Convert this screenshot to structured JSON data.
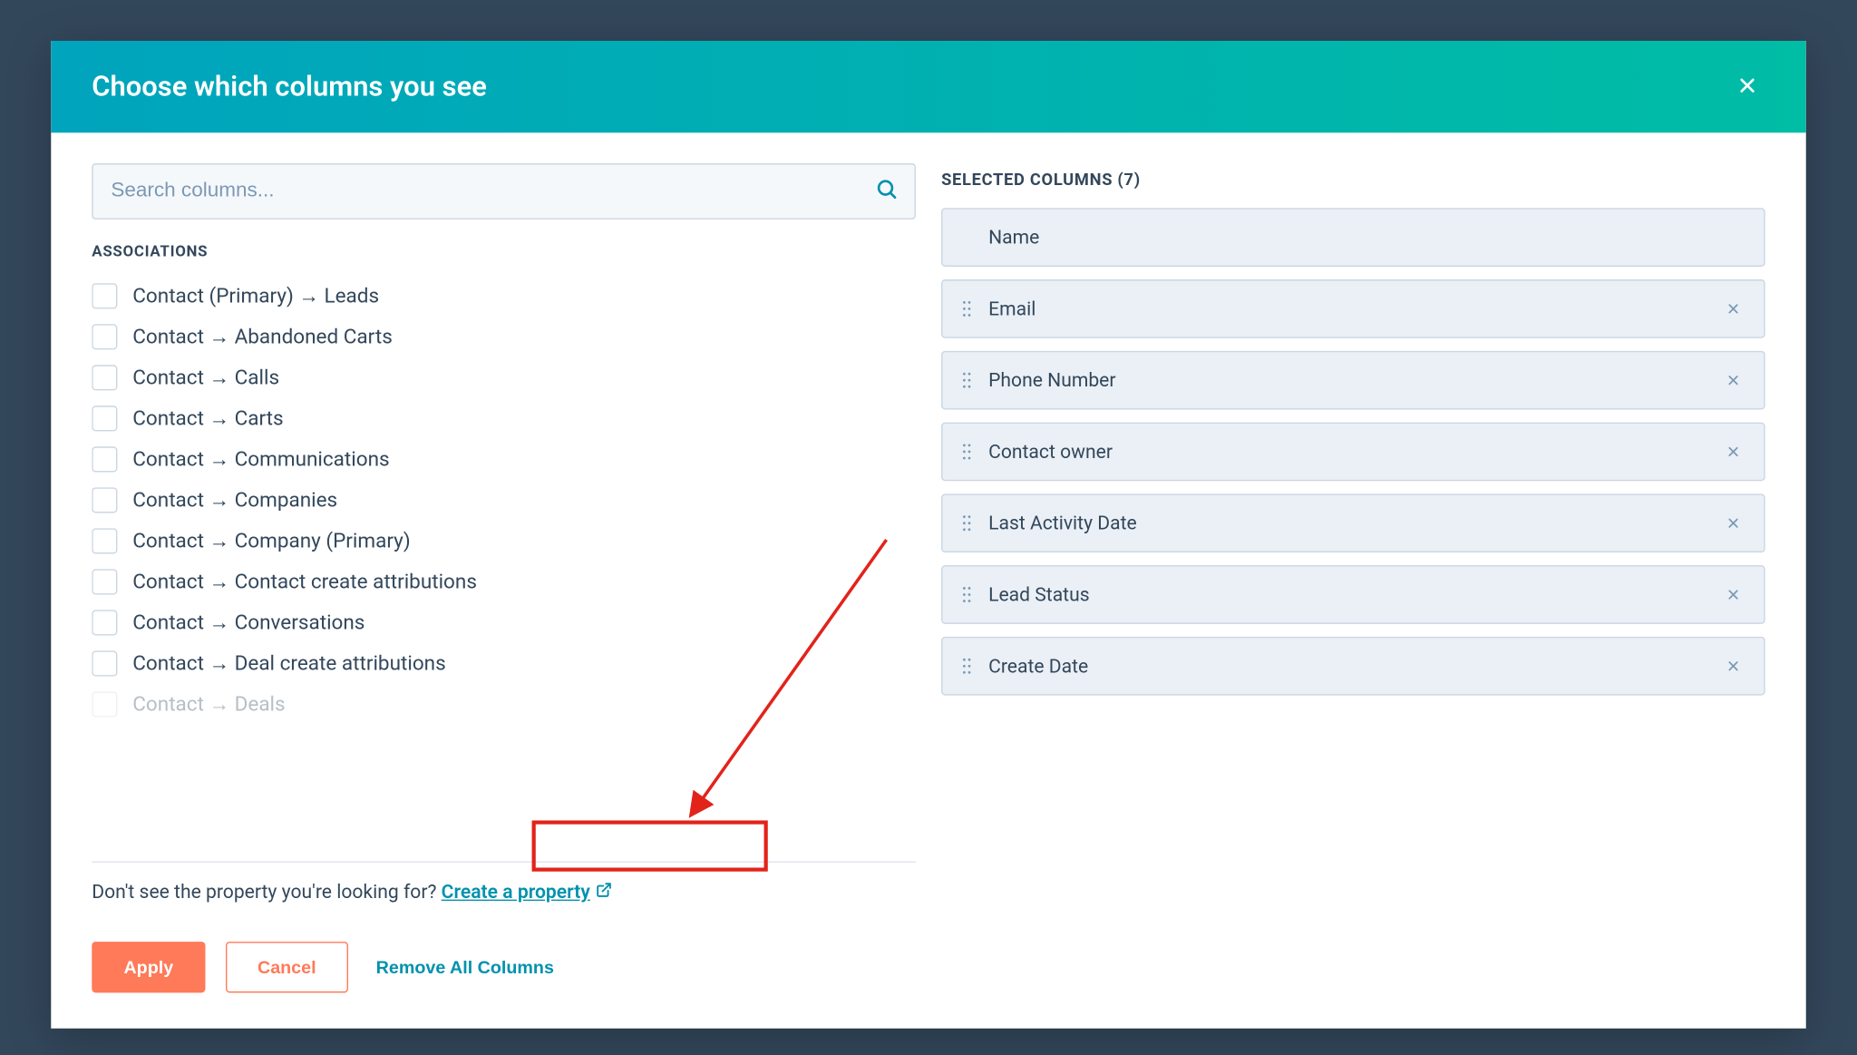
{
  "modal": {
    "title": "Choose which columns you see",
    "search_placeholder": "Search columns..."
  },
  "associations": {
    "section_label": "Associations",
    "items": [
      {
        "label": "Contact (Primary) → Leads"
      },
      {
        "label": "Contact → Abandoned Carts"
      },
      {
        "label": "Contact → Calls"
      },
      {
        "label": "Contact → Carts"
      },
      {
        "label": "Contact → Communications"
      },
      {
        "label": "Contact → Companies"
      },
      {
        "label": "Contact → Company (Primary)"
      },
      {
        "label": "Contact → Contact create attributions"
      },
      {
        "label": "Contact → Conversations"
      },
      {
        "label": "Contact → Deal create attributions"
      },
      {
        "label": "Contact → Deals"
      }
    ]
  },
  "selected": {
    "header": "SELECTED COLUMNS (7)",
    "items": [
      {
        "label": "Name",
        "locked": true
      },
      {
        "label": "Email",
        "locked": false
      },
      {
        "label": "Phone Number",
        "locked": false
      },
      {
        "label": "Contact owner",
        "locked": false
      },
      {
        "label": "Last Activity Date",
        "locked": false
      },
      {
        "label": "Lead Status",
        "locked": false
      },
      {
        "label": "Create Date",
        "locked": false
      }
    ]
  },
  "create_property": {
    "prompt": "Don't see the property you're looking for? ",
    "link_text": "Create a property"
  },
  "footer": {
    "apply": "Apply",
    "cancel": "Cancel",
    "remove_all": "Remove All Columns"
  }
}
